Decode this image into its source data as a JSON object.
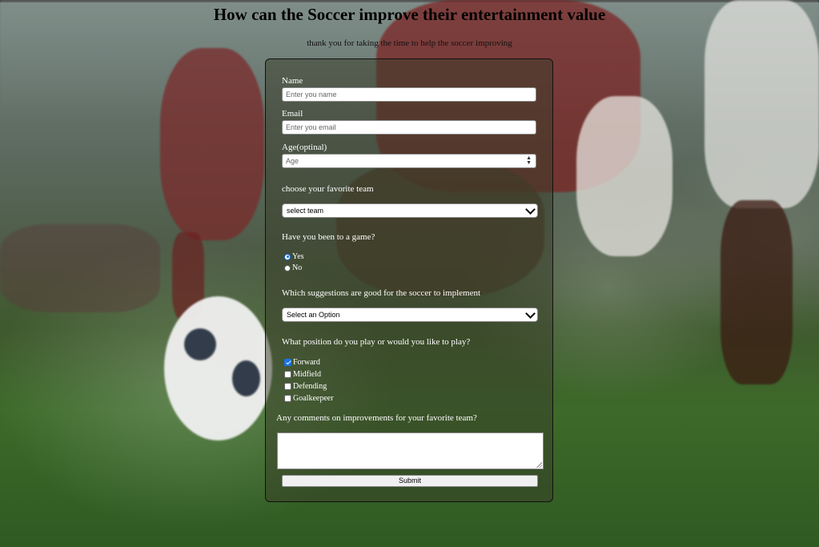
{
  "page": {
    "title": "How can the Soccer improve their entertainment value",
    "subtitle": "thank you for taking the time to help the soccer improving"
  },
  "form": {
    "name_label": "Name",
    "name_placeholder": "Enter you name",
    "email_label": "Email",
    "email_placeholder": "Enter you email",
    "age_label": "Age(optinal)",
    "age_placeholder": "Age",
    "team_label": "choose your favorite team",
    "team_selected": "select team",
    "game_question": "Have you been to a game?",
    "game_options": [
      "Yes",
      "No"
    ],
    "game_selected": "Yes",
    "suggestions_label": "Which suggestions are good for the soccer to implement",
    "suggestions_selected": "Select an Option",
    "position_label": "What position do you play or would you like to play?",
    "positions": [
      "Forward",
      "Midfield",
      "Defending",
      "Goalkeepeer"
    ],
    "positions_checked": [
      "Forward"
    ],
    "comments_label": "Any comments on improvements for your favorite team?",
    "comments_value": "",
    "submit_label": "Submit"
  },
  "colors": {
    "accent": "#1a73e8",
    "card_border": "#111111"
  },
  "icons": [
    "chevron-down-icon",
    "spinner-arrows-icon",
    "resize-handle-icon",
    "checkmark-icon"
  ]
}
